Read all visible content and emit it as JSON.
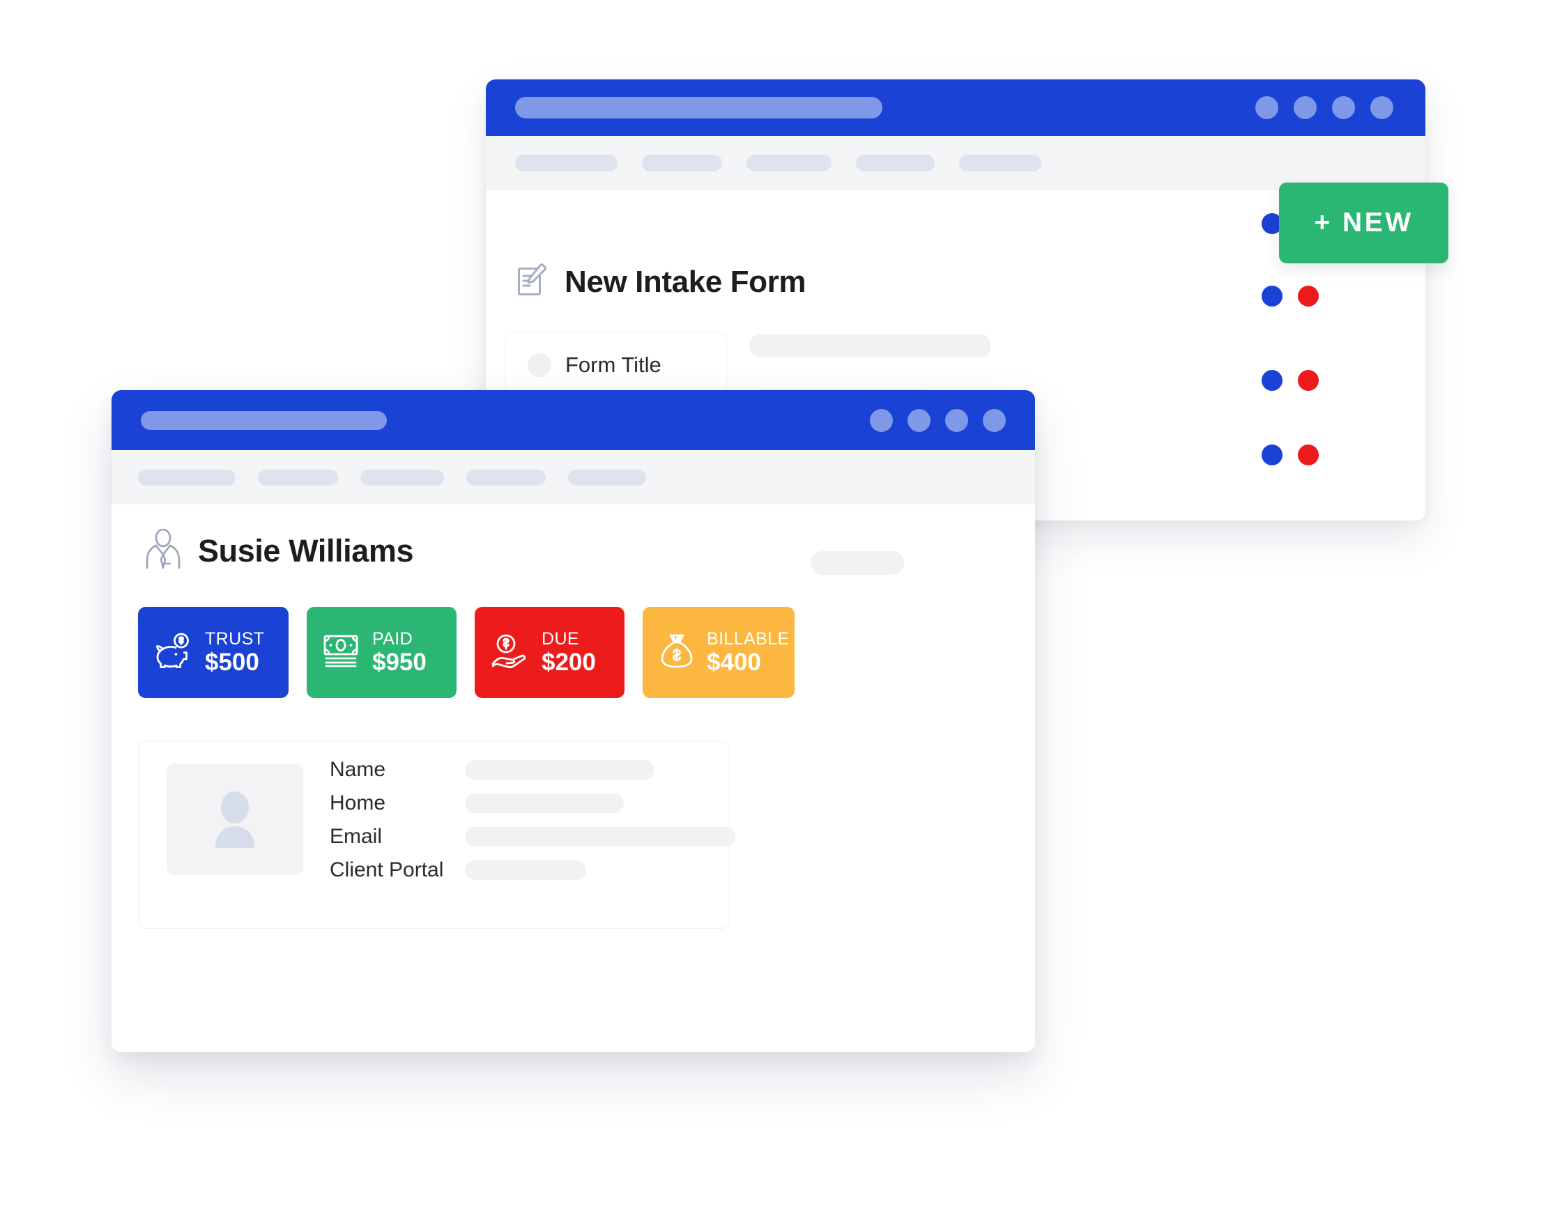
{
  "scene": {
    "background": "#ffffff",
    "description": "Two overlapping browser-style app windows, legal practice management mock-up"
  },
  "colors": {
    "brand_blue": "#1A42D4",
    "title_pill_blue": "#8098E8",
    "green": "#2BB673",
    "red": "#ED1C1C",
    "amber": "#FBB740",
    "toolbar_bg": "#F4F5F7",
    "toolbar_chip": "#DFE3ED",
    "placeholder_gray": "#F2F2F4"
  },
  "back_window": {
    "name": "New Intake Form window",
    "titlebar": {
      "address_pill": "",
      "dots": [
        "",
        "",
        "",
        ""
      ]
    },
    "toolbar": {
      "chips": [
        "",
        "",
        "",
        "",
        ""
      ]
    },
    "page_title": "New Intake Form",
    "page_title_icon": "form-edit-icon",
    "form_title_card": {
      "bullet": "",
      "label": "Form Title"
    },
    "placeholder_rows": [
      {
        "kind": "bar"
      },
      {
        "kind": "bar"
      },
      {
        "kind": "bar"
      },
      {
        "kind": "box"
      },
      {
        "kind": "box"
      }
    ],
    "status_dot_pairs": [
      {
        "blue": "#1A42D4",
        "red": "#ED1C1C"
      },
      {
        "blue": "#1A42D4",
        "red": "#ED1C1C"
      },
      {
        "blue": "#1A42D4",
        "red": "#ED1C1C"
      },
      {
        "blue": "#1A42D4",
        "red": "#ED1C1C"
      }
    ]
  },
  "new_button": {
    "label": "+ NEW",
    "color": "#2BB673"
  },
  "front_window": {
    "name": "Client detail window",
    "titlebar": {
      "address_pill": "",
      "dots": [
        "",
        "",
        "",
        ""
      ]
    },
    "toolbar": {
      "chips": [
        "",
        "",
        "",
        "",
        ""
      ]
    },
    "client": {
      "name": "Susie Williams",
      "avatar_icon": "businessperson-icon"
    },
    "stats": [
      {
        "label": "TRUST",
        "value": "$500",
        "color": "#1A42D4",
        "icon": "piggy-bank-icon"
      },
      {
        "label": "PAID",
        "value": "$950",
        "color": "#2BB673",
        "icon": "banknote-icon"
      },
      {
        "label": "DUE",
        "value": "$200",
        "color": "#ED1C1C",
        "icon": "hand-coin-icon"
      },
      {
        "label": "BILLABLE",
        "value": "$400",
        "color": "#FBB740",
        "icon": "money-bag-icon"
      }
    ],
    "detail_card": {
      "photo_icon": "user-avatar-icon",
      "fields": [
        {
          "label": "Name",
          "value": "",
          "value_width": 272
        },
        {
          "label": "Home",
          "value": "",
          "value_width": 228
        },
        {
          "label": "Email",
          "value": "",
          "value_width": 388
        },
        {
          "label": "Client Portal",
          "value": "",
          "value_width": 174
        }
      ]
    }
  }
}
